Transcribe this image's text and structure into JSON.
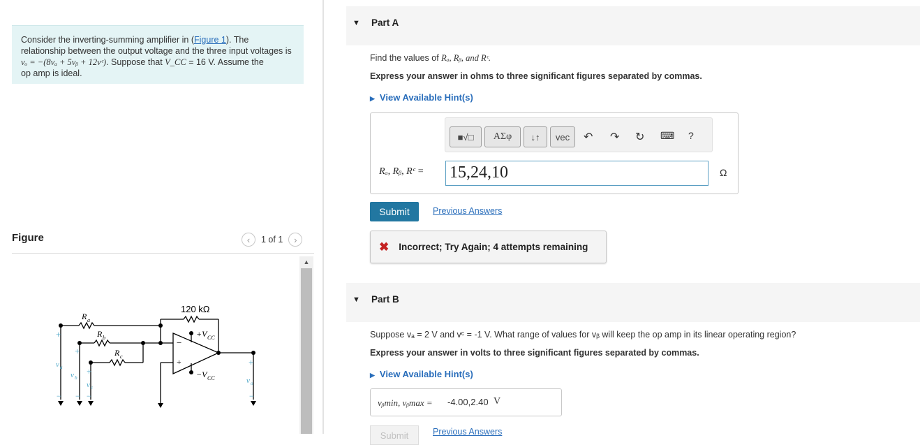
{
  "problem": {
    "line1_pre": "Consider the inverting-summing amplifier in (",
    "figure_link": "Figure 1",
    "line1_post": "). The",
    "line2": "relationship between the output voltage and the three input voltages is",
    "equation": "vₒ = −(8vₐ + 5vᵦ + 12vᶜ)",
    "line3_mid": ". Suppose that ",
    "vcc_sym": "V_CC",
    "vcc_val": " = 16 V. Assume the",
    "line4": "op amp is ideal."
  },
  "figure": {
    "title": "Figure",
    "pager": "1 of 1",
    "prev_icon": "chevron-left-icon",
    "next_icon": "chevron-right-icon",
    "labels": {
      "rf": "120 kΩ",
      "ra": "R",
      "ra_sub": "a",
      "rb": "R",
      "rb_sub": "b",
      "rc": "R",
      "rc_sub": "c",
      "vcc_pos": "+V",
      "vcc_pos_sub": "CC",
      "vcc_neg": "−V",
      "vcc_neg_sub": "CC",
      "va": "v",
      "va_sub": "a",
      "vb": "v",
      "vb_sub": "b",
      "vc": "v",
      "vc_sub": "c",
      "vo": "v",
      "vo_sub": "o",
      "plus": "+",
      "minus": "−"
    }
  },
  "partA": {
    "label": "Part A",
    "prompt_pre": "Find the values of ",
    "prompt_vars": "Rₐ, Rᵦ, and Rᶜ.",
    "instruction": "Express your answer in ohms to three significant figures separated by commas.",
    "hint": "View Available Hint(s)",
    "toolbar": {
      "templates": "■√□",
      "greek": "ΑΣφ",
      "arrows": "↓↑",
      "vec": "vec",
      "undo_icon": "undo-icon",
      "redo_icon": "redo-icon",
      "reset_icon": "reset-icon",
      "keyboard_icon": "keyboard-icon",
      "help": "?"
    },
    "eq_label": "Rₐ, Rᵦ, Rᶜ =",
    "answer": "15,24,10",
    "unit": "Ω",
    "submit": "Submit",
    "previous": "Previous Answers",
    "feedback": "Incorrect; Try Again; 4 attempts remaining"
  },
  "partB": {
    "label": "Part B",
    "prompt": "Suppose vₐ = 2 V and vᶜ = -1 V. What range of values for vᵦ will keep the op amp in its linear operating region?",
    "instruction": "Express your answer in volts to three significant figures separated by commas.",
    "hint": "View Available Hint(s)",
    "eq_label": "vᵦmin, vᵦmax =",
    "answer": "-4.00,2.40",
    "unit": "V",
    "submit": "Submit",
    "previous": "Previous Answers"
  }
}
